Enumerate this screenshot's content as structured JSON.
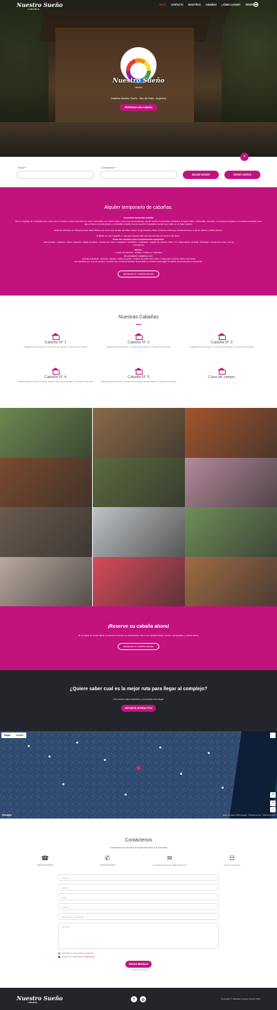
{
  "brand": {
    "name": "Nuestro Sueño",
    "tagline": "cabañas"
  },
  "nav": {
    "links": [
      {
        "label": "INICIO",
        "active": true
      },
      {
        "label": "CONTACTO"
      },
      {
        "label": "NOSOTROS"
      },
      {
        "label": "CABAÑAS"
      },
      {
        "label": "¿CÓMO LLEGAR?"
      },
      {
        "label": "RESERVAR"
      }
    ],
    "user_icon": "user-circle-icon"
  },
  "hero": {
    "logo_title": "Nuestro Sueño",
    "logo_sub": "cabañas",
    "caption": "Cabañas Nuestro Sueño - Mar del Plata - Argentina",
    "cta": "RESERVAR UNA CABAÑA"
  },
  "login": {
    "email_label": "Email",
    "password_label": "Contraseña",
    "required_mark": "*",
    "login_button": "INICIAR SESIÓN",
    "create_button": "CREAR CUENTA"
  },
  "alquiler": {
    "title": "Alquiler temporario de cabañas.",
    "p1": "\"CABAÑAS NUESTRO SUEÑO\"",
    "p2": "Es un complejo de 4 cabañas que nació como un sueño y está construido con amor, decoradas con mucho gusto y de forma personalizada, siendo nuestro compromiso brindarles un lugar cálido, confortable, tranquilo, con buenas energías y un ambiente familiar, para que se lleven una placentera e inolvidable estadía, donde nuestros huéspedes sientan que están en un lugar soñado.",
    "p3": "Estamos ubicados en Pasquero Quo Vadis 5946 en la zona norte de Mar del Plata. Altura: Jorge Newbery 5900, Próximos al Bosque Peralta Ramos y a las Av. Edison y Martín Rivero.",
    "p4": "El Barrio es muy tranquilo, y más aún nuestra calle que sólo circulan los vecinos del barrio.",
    "equip_title": "Todas las cabañas están completamente equipadas:",
    "equip": "• Microondas • Cafetera • Pava • Juguera • Vajilla completa • Cocina con horno • Heladera • Ventilador • Calefactor • Equipo de música • WiFi • TV • Reproductor de DVD • Películas • Juegos de mesa • Luz de emergencia",
    "blanco_title": "Blanco:",
    "blanco": "• Juego de sábanas • Toallas • Toallones • Manteles",
    "exterior_title": "En el exterior contamos con:",
    "exterior": "• Parrilla individual • Quincho • Mesas y sillas de jardín • Juegos de jardín para niños • Lugar para vehículo dentro del predio",
    "closing": "Las cabañas son muy luminosas y cuentan con ventanas amplias. Decoradas en madera para lograr la calidez necesaria para el descanso.",
    "button": "RESERVE SU CABAÑA AHORA"
  },
  "cabanas": {
    "title": "Nuestras Cabañas",
    "items": [
      {
        "name": "Cabaña N° 1",
        "desc": "Cabaña para 4 personas, 1 somier de dos plazas y 2 somier de una plaza"
      },
      {
        "name": "Cabaña N° 2",
        "desc": "Cabaña para 4 personas, 1 somier de dos plazas y 2 somier de una plaza"
      },
      {
        "name": "Cabaña N° 3",
        "desc": "Cabaña para 4 personas, 1 somier de dos plazas y 2 somier de una plaza"
      },
      {
        "name": "Cabaña N° 4",
        "desc": "Cabaña para 5 personas, 1 somier transformable de dos plazas y 3 camas de una plaza"
      },
      {
        "name": "Cabaña N° 5",
        "desc": "Cabaña para 5 personas, 1 somier transformable de dos plazas y 3 camas de una plaza"
      },
      {
        "name": "Casa de campo",
        "desc": ""
      }
    ]
  },
  "gallery": {
    "colors": [
      "#6b8a4e",
      "#8a6a46",
      "#a3552c",
      "#7a4a2c",
      "#5c6b3e",
      "#b48a9a",
      "#6a5a4e",
      "#bfc3c6",
      "#6f8f5a",
      "#b9a89e",
      "#d84a5a",
      "#a06b44"
    ]
  },
  "reserve": {
    "title": "¡Reserve su cabaña ahora!",
    "text": "El complejo se ocupa rápido lo pedimos reservar con anticipación más si son feriados largos, verano, temporadas y reserve ahora",
    "button": "RESERVE SU CABAÑA AHORA"
  },
  "ruta": {
    "title": "¿Quiere saber cual es la mejor ruta para llegar al complejo?",
    "text": "Use nuestro mapa interactivo y encontrará como llegar.",
    "button": "VER MAPA INTERACTIVO"
  },
  "map": {
    "tab_map": "Mapa",
    "tab_sat": "Satélite",
    "google": "Google",
    "attribution": "Datos del mapa ©2023 Google · Términos de uso · Informar un error"
  },
  "contact": {
    "title": "Contáctenos",
    "subtitle": "Contáctese con nosotros se responderemos a la brevedad",
    "items": [
      {
        "icon": "phone-icon",
        "text": "+5402235018033"
      },
      {
        "icon": "whatsapp-icon",
        "text": "+5402235018033"
      },
      {
        "icon": "email-icon",
        "text": "complejonuestrosueno@hotmail.com"
      },
      {
        "icon": "calendar-icon",
        "text": "Crear una reserva"
      }
    ],
    "fields": [
      "Nombre",
      "Apellido",
      "Email",
      "Teléfono",
      "Seleccione una cabaña",
      "Mensaje"
    ],
    "newsletter": "Suscribirme para recibir newsletter",
    "terms_prefix": "Acepto los",
    "terms_link": "Términos y condiciones",
    "send": "ENVIAR MENSAJE",
    "required_note": "(*) Datos requeridos"
  },
  "footer": {
    "brand": "Nuestro Sueño",
    "tagline": "cabañas",
    "copyright": "Copyright © Cabañas Nuestro Sueño 2023"
  }
}
